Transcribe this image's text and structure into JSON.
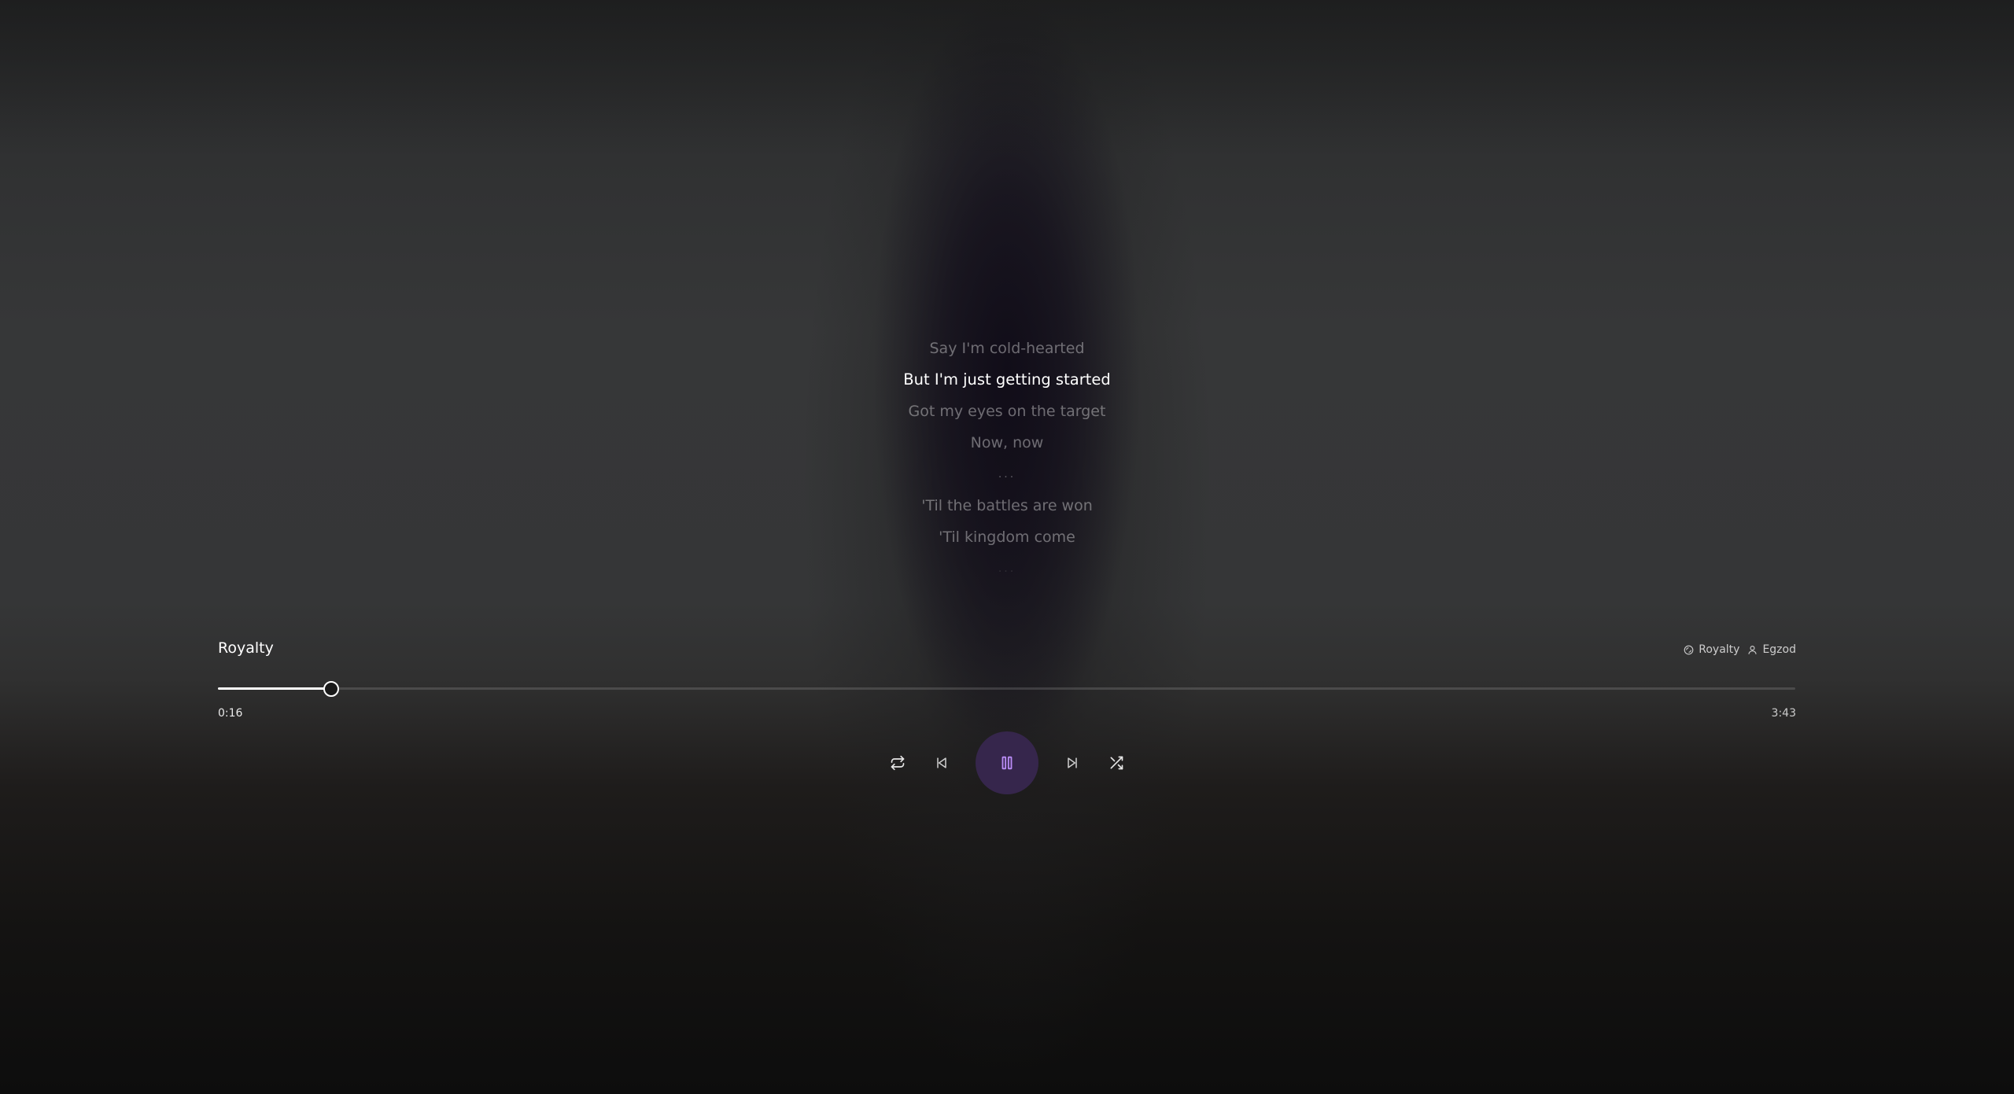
{
  "lyrics": {
    "lines": [
      {
        "text": "Say I'm cold-hearted",
        "state": "past"
      },
      {
        "text": "But I'm just getting started",
        "state": "active"
      },
      {
        "text": "Got my eyes on the target",
        "state": "upcoming"
      },
      {
        "text": "Now, now",
        "state": "upcoming"
      },
      {
        "text": "...",
        "state": "pause"
      },
      {
        "text": "'Til the battles are won",
        "state": "upcoming"
      },
      {
        "text": "'Til kingdom come",
        "state": "upcoming"
      },
      {
        "text": "...",
        "state": "faint"
      }
    ]
  },
  "track": {
    "title": "Royalty",
    "album": "Royalty",
    "artist": "Egzod"
  },
  "progress": {
    "elapsed": "0:16",
    "total": "3:43",
    "fraction": 0.0717
  },
  "controls": {
    "repeat_icon": "repeat-icon",
    "previous_icon": "skip-previous-icon",
    "play_state_icon": "pause-icon",
    "next_icon": "skip-next-icon",
    "shuffle_icon": "shuffle-icon"
  },
  "colors": {
    "accent": "#b98cf5",
    "play_button_bg": "#36264c",
    "active_lyric": "#ffffff"
  }
}
